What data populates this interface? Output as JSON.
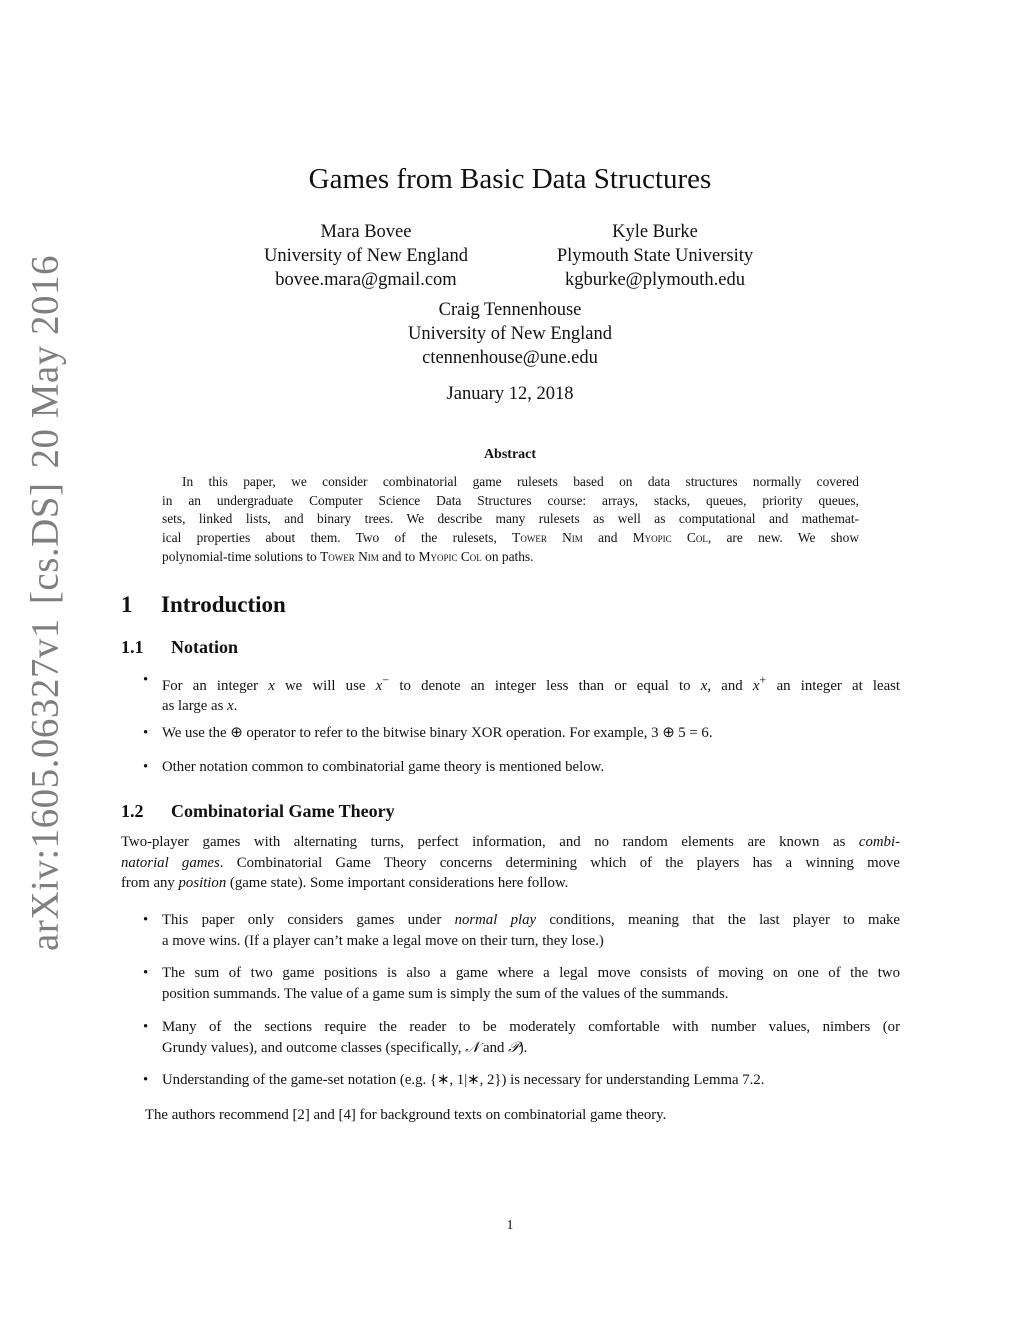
{
  "watermark": {
    "id": "arXiv:1605.06327v1",
    "category": "[cs.DS]",
    "date": "20 May 2016"
  },
  "title": "Games from Basic Data Structures",
  "authors": [
    {
      "name": "Mara Bovee",
      "affiliation": "University of New England",
      "email": "bovee.mara@gmail.com"
    },
    {
      "name": "Kyle Burke",
      "affiliation": "Plymouth State University",
      "email": "kgburke@plymouth.edu"
    },
    {
      "name": "Craig Tennenhouse",
      "affiliation": "University of New England",
      "email": "ctennenhouse@une.edu"
    }
  ],
  "date": "January 12, 2018",
  "abstract": {
    "heading": "Abstract",
    "lines": [
      "In this paper, we consider combinatorial game rulesets based on data structures normally covered",
      "in an undergraduate Computer Science Data Structures course: arrays, stacks, queues, priority queues,",
      "sets, linked lists, and binary trees. We describe many rulesets as well as computational and mathemat-",
      [
        "ical properties about them.  Two of the rulesets, ",
        "Tower Nim",
        " and ",
        "Myopic Col",
        ", are new.  We show"
      ],
      [
        "polynomial-time solutions to ",
        "Tower Nim",
        " and to ",
        "Myopic Col",
        " on paths."
      ]
    ]
  },
  "section1": {
    "number": "1",
    "title": "Introduction",
    "sub1": {
      "number": "1.1",
      "title": "Notation",
      "bullets": [
        {
          "line1": [
            "For an integer ",
            "x",
            " we will use ",
            "x",
            "−",
            " to denote an integer less than or equal to ",
            "x",
            ", and ",
            "x",
            "+",
            " an integer at least"
          ],
          "line2": [
            "as large as ",
            "x",
            "."
          ]
        },
        {
          "line1": [
            "We use the ",
            "⊕",
            " operator to refer to the bitwise binary XOR operation. For example, 3 ⊕ 5 = 6."
          ]
        },
        {
          "line1": [
            "Other notation common to combinatorial game theory is mentioned below."
          ]
        }
      ]
    },
    "sub2": {
      "number": "1.2",
      "title": "Combinatorial Game Theory",
      "intro": {
        "l1a": "Two-player games with alternating turns, perfect information, and no random elements are known as ",
        "l1b": "combi-",
        "l2a": "natorial games",
        "l2b": ". Combinatorial Game Theory concerns determining which of the players has a winning move",
        "l3a": "from any ",
        "l3b": "position",
        "l3c": " (game state). Some important considerations here follow."
      },
      "bullets": [
        {
          "l1a": "This paper only considers games under ",
          "l1b": "normal play",
          "l1c": " conditions, meaning that the last player to make",
          "l2": "a move wins. (If a player can’t make a legal move on their turn, they lose.)"
        },
        {
          "l1": "The sum of two game positions is also a game where a legal move consists of moving on one of the two",
          "l2": "position summands. The value of a game sum is simply the sum of the values of the summands."
        },
        {
          "l1": "Many of the sections require the reader to be moderately comfortable with number values, nimbers (or",
          "l2a": "Grundy values), and outcome classes (specifically, ",
          "l2b": "𝒩",
          "l2c": " and ",
          "l2d": "𝒫",
          "l2e": ")."
        },
        {
          "l1": "Understanding of the game-set notation (e.g. {∗, 1|∗, 2}) is necessary for understanding Lemma 7.2."
        }
      ],
      "closing": "The authors recommend [2] and [4] for background texts on combinatorial game theory."
    }
  },
  "page_number": "1"
}
